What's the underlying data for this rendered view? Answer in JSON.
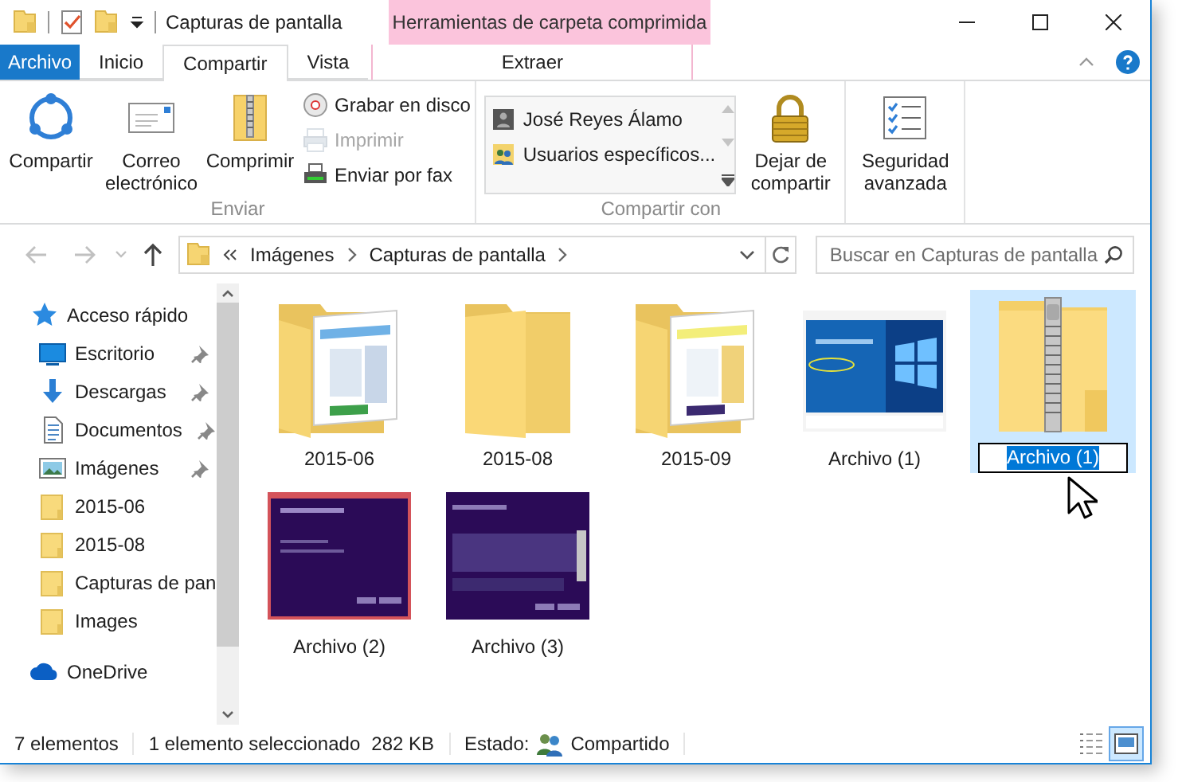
{
  "window": {
    "title": "Capturas de pantalla",
    "contextual_header": "Herramientas de carpeta comprimida"
  },
  "ribbon_tabs": [
    {
      "label": "Archivo",
      "kind": "file",
      "selected": false
    },
    {
      "label": "Inicio",
      "kind": "tab",
      "selected": false
    },
    {
      "label": "Compartir",
      "kind": "tab",
      "selected": true
    },
    {
      "label": "Vista",
      "kind": "tab",
      "selected": false
    },
    {
      "label": "Extraer",
      "kind": "contextual",
      "selected": false
    }
  ],
  "ribbon_groups": [
    {
      "label": "Enviar",
      "commands": [
        {
          "kind": "large",
          "label": "Compartir",
          "disabled": false
        },
        {
          "kind": "large",
          "label": "Correo electrónico",
          "disabled": false
        },
        {
          "kind": "large",
          "label": "Comprimir",
          "disabled": false
        },
        {
          "kind": "small",
          "label": "Grabar en disco",
          "disabled": false
        },
        {
          "kind": "small",
          "label": "Imprimir",
          "disabled": true
        },
        {
          "kind": "small",
          "label": "Enviar por fax",
          "disabled": false
        }
      ]
    },
    {
      "label": "Compartir con",
      "commands": [
        {
          "kind": "list",
          "items": [
            "José Reyes Álamo",
            "Usuarios específicos..."
          ]
        },
        {
          "kind": "large",
          "label": "Dejar de compartir",
          "disabled": false
        }
      ]
    },
    {
      "commands": [
        {
          "kind": "large",
          "label": "Seguridad avanzada",
          "disabled": false
        }
      ]
    }
  ],
  "navigation": [
    {
      "kind": "back",
      "disabled": true
    },
    {
      "kind": "forward",
      "disabled": true
    },
    {
      "kind": "recent",
      "disabled": true
    },
    {
      "kind": "up",
      "disabled": false
    }
  ],
  "address_bar": {
    "path": [
      "Imágenes",
      "Capturas de pantalla"
    ]
  },
  "search": {
    "placeholder": "Buscar en Capturas de pantalla"
  },
  "nav_pane": [
    {
      "label": "Acceso rápido",
      "kind": "quick_access",
      "children": [
        {
          "label": "Escritorio",
          "kind": "desktop",
          "pinned": true
        },
        {
          "label": "Descargas",
          "kind": "downloads",
          "pinned": true
        },
        {
          "label": "Documentos",
          "kind": "documents",
          "pinned": true
        },
        {
          "label": "Imágenes",
          "kind": "pictures",
          "pinned": true
        },
        {
          "label": "2015-06",
          "kind": "folder",
          "pinned": false
        },
        {
          "label": "2015-08",
          "kind": "folder",
          "pinned": false
        },
        {
          "label": "Capturas de pan",
          "kind": "folder",
          "pinned": false
        },
        {
          "label": "Images",
          "kind": "folder",
          "pinned": false
        }
      ]
    },
    {
      "label": "OneDrive",
      "kind": "onedrive"
    }
  ],
  "items": [
    {
      "label": "2015-06",
      "kind": "folder_preview",
      "selected": false,
      "renaming": false
    },
    {
      "label": "2015-08",
      "kind": "folder",
      "selected": false,
      "renaming": false
    },
    {
      "label": "2015-09",
      "kind": "folder_preview",
      "selected": false,
      "renaming": false
    },
    {
      "label": "Archivo (1)",
      "selected": false,
      "renaming": false
    },
    {
      "label": "Archivo (1)",
      "kind": "zip",
      "selected": true,
      "renaming": true
    },
    {
      "label": "Archivo (2)",
      "selected": false,
      "renaming": false
    },
    {
      "label": "Archivo (3)",
      "selected": false,
      "renaming": false
    }
  ],
  "status_bar": {
    "item_count": "7 elementos",
    "selection": "1 elemento seleccionado",
    "size": "282 KB",
    "state_label": "Estado:",
    "state": "Compartido",
    "views": [
      {
        "kind": "details",
        "selected": false
      },
      {
        "kind": "large_icons",
        "selected": true
      }
    ]
  }
}
